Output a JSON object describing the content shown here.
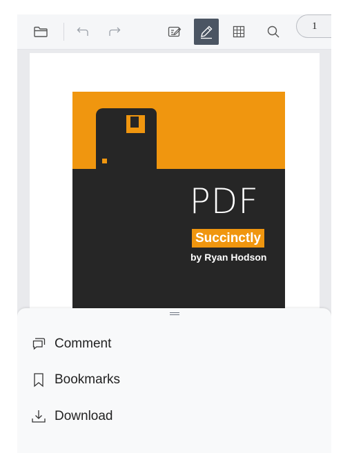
{
  "toolbar": {
    "buttons": [
      {
        "icon": "folder-open-icon"
      },
      {
        "icon": "undo-icon"
      },
      {
        "icon": "redo-icon"
      },
      {
        "icon": "annotate-icon"
      },
      {
        "icon": "pen-icon",
        "active": true
      },
      {
        "icon": "form-fields-icon"
      },
      {
        "icon": "search-icon"
      },
      {
        "icon": "more-vertical-icon"
      }
    ]
  },
  "viewer": {
    "page_number": "1",
    "cover": {
      "title": "PDF",
      "series": "Succinctly",
      "author": "by Ryan Hodson"
    }
  },
  "sheet": {
    "items": [
      {
        "label": "Comment",
        "icon": "comment-icon"
      },
      {
        "label": "Bookmarks",
        "icon": "bookmark-icon"
      },
      {
        "label": "Download",
        "icon": "download-icon"
      }
    ]
  },
  "colors": {
    "accent_orange": "#f0960f",
    "cover_dark": "#262626",
    "active_tool": "#4b5563"
  }
}
